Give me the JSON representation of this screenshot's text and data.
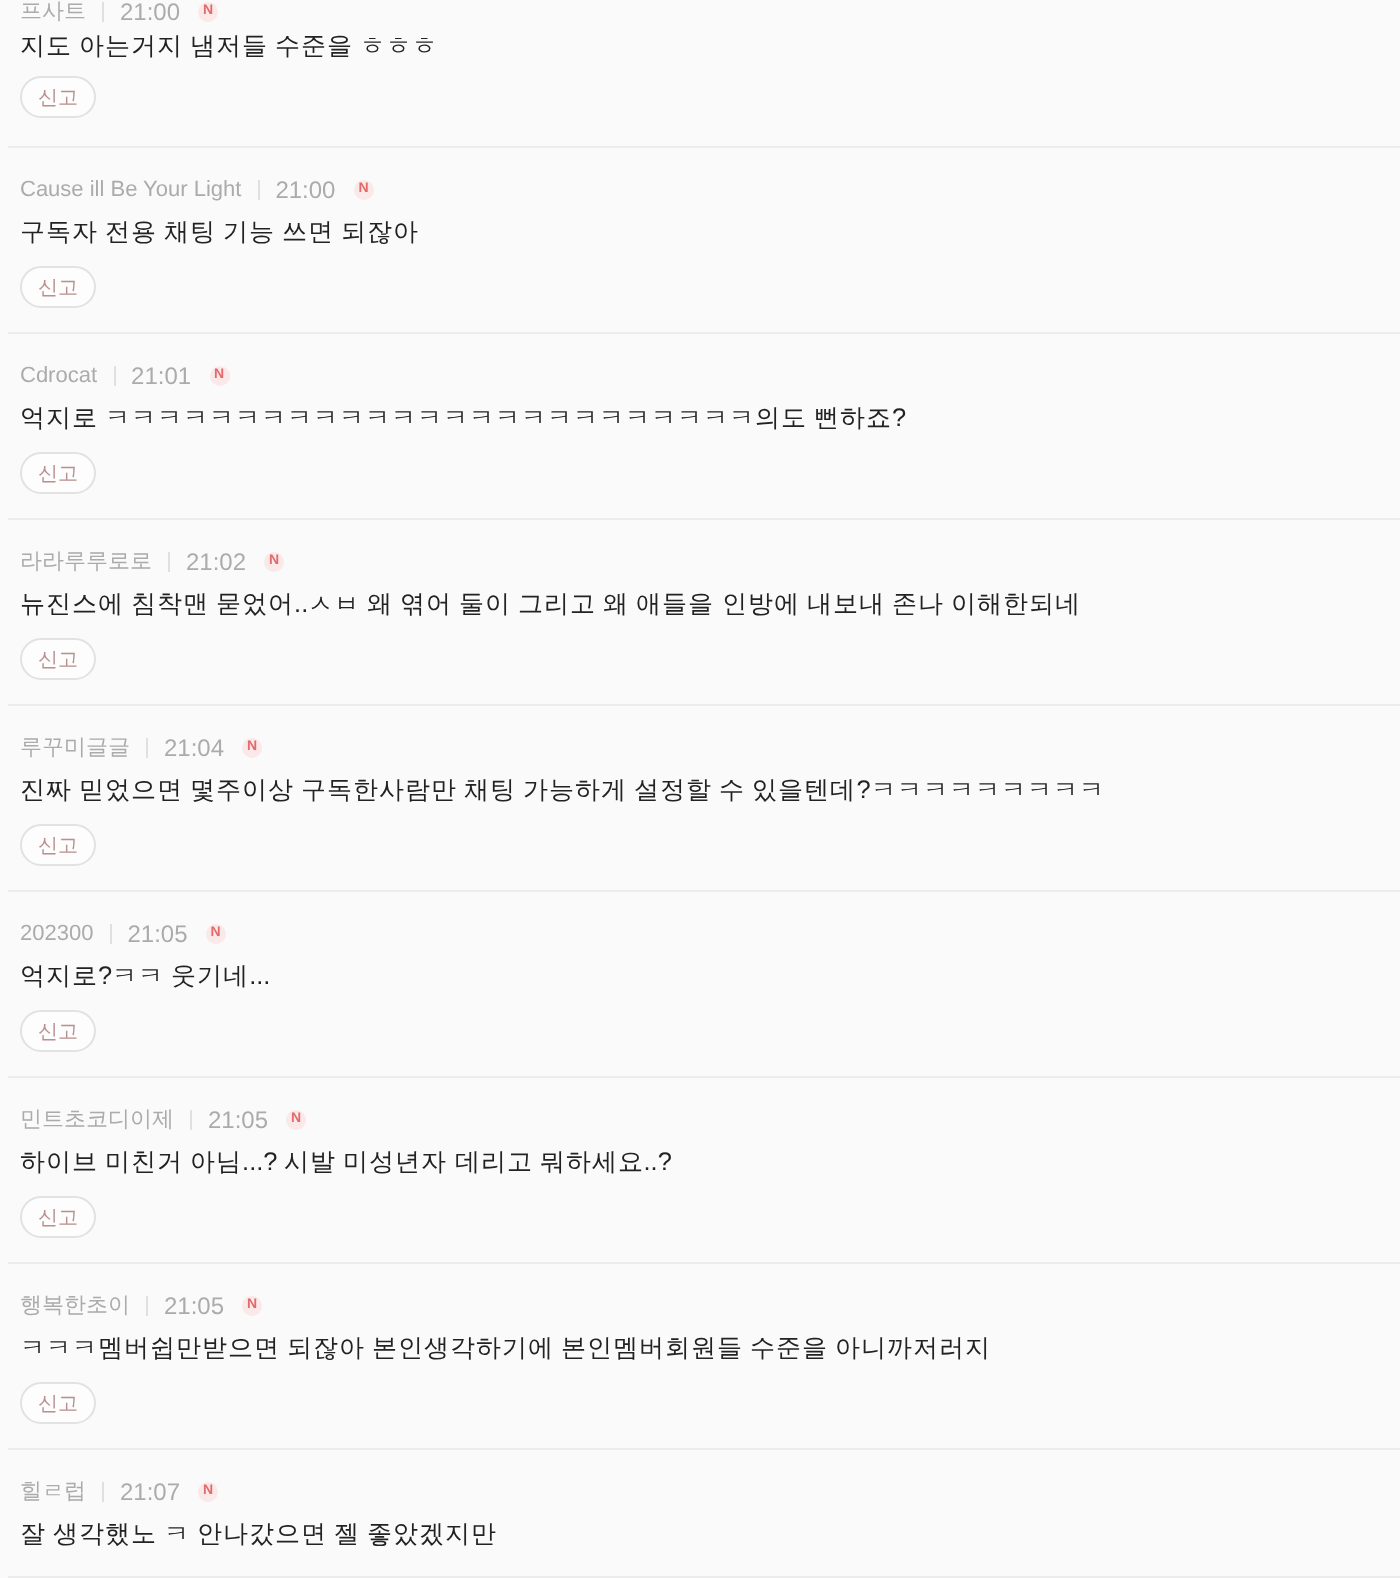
{
  "comments": [
    {
      "author": "프사트",
      "time": "21:00",
      "badge": "N",
      "text": "지도 아는거지 냄저들 수준을 ㅎㅎㅎ",
      "report": "신고"
    },
    {
      "author": "Cause ill Be Your Light",
      "time": "21:00",
      "badge": "N",
      "text": "구독자 전용 채팅 기능 쓰면 되잖아",
      "report": "신고"
    },
    {
      "author": "Cdrocat",
      "time": "21:01",
      "badge": "N",
      "text": "억지로 ㅋㅋㅋㅋㅋㅋㅋㅋㅋㅋㅋㅋㅋㅋㅋㅋㅋㅋㅋㅋㅋㅋㅋㅋㅋ의도 뻔하죠?",
      "report": "신고"
    },
    {
      "author": "라라루루로로",
      "time": "21:02",
      "badge": "N",
      "text": "뉴진스에 침착맨 묻었어..ㅅㅂ 왜 엮어 둘이 그리고 왜 애들을 인방에 내보내 존나 이해한되네",
      "report": "신고"
    },
    {
      "author": "루꾸미글글",
      "time": "21:04",
      "badge": "N",
      "text": "진짜 믿었으면 몇주이상 구독한사람만 채팅 가능하게 설정할 수 있을텐데?ㅋㅋㅋㅋㅋㅋㅋㅋㅋ",
      "report": "신고"
    },
    {
      "author": "202300",
      "time": "21:05",
      "badge": "N",
      "text": "억지로?ㅋㅋ 웃기네...",
      "report": "신고"
    },
    {
      "author": "민트초코디이제",
      "time": "21:05",
      "badge": "N",
      "text": "하이브 미친거 아님...? 시발 미성년자 데리고 뭐하세요..?",
      "report": "신고"
    },
    {
      "author": "행복한초이",
      "time": "21:05",
      "badge": "N",
      "text": "ㅋㅋㅋ멤버쉽만받으면 되잖아 본인생각하기에 본인멤버회원들 수준을 아니까저러지",
      "report": "신고"
    },
    {
      "author": "힐ㄹ럽",
      "time": "21:07",
      "badge": "N",
      "text": "잘 생각했노 ㅋ 안나갔으면 젤 좋았겠지만"
    }
  ]
}
